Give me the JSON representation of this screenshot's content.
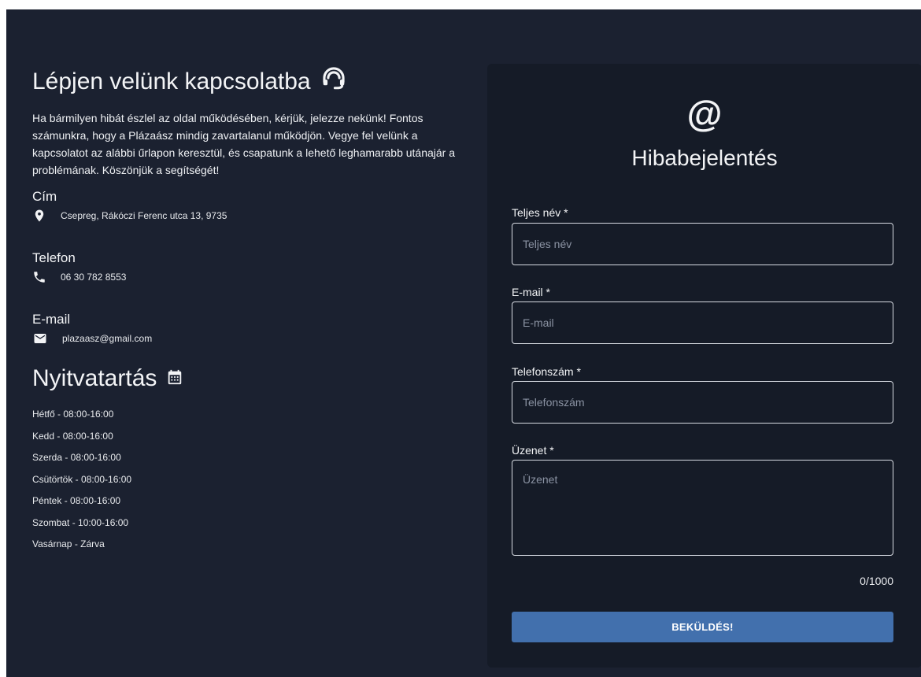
{
  "contact": {
    "title": "Lépjen velünk kapcsolatba",
    "title_icon": "headset-icon",
    "intro": "Ha bármilyen hibát észlel az oldal működésében, kérjük, jelezze nekünk! Fontos számunkra, hogy a Plázaász mindig zavartalanul működjön. Vegye fel velünk a kapcsolatot az alábbi űrlapon keresztül, és csapatunk a lehető leghamarabb utánajár a problémának. Köszönjük a segítségét!",
    "address_label": "Cím",
    "address": "Csepreg, Rákóczi Ferenc utca 13, 9735",
    "phone_label": "Telefon",
    "phone": "06 30 782 8553",
    "email_label": "E-mail",
    "email": "plazaasz@gmail.com"
  },
  "hours": {
    "title": "Nyitvatartás",
    "title_icon": "calendar-icon",
    "items": [
      "Hétfő - 08:00-16:00",
      "Kedd - 08:00-16:00",
      "Szerda - 08:00-16:00",
      "Csütörtök - 08:00-16:00",
      "Péntek - 08:00-16:00",
      "Szombat - 10:00-16:00",
      "Vasárnap - Zárva"
    ]
  },
  "form": {
    "icon": "@",
    "title": "Hibabejelentés",
    "name_label": "Teljes név *",
    "name_placeholder": "Teljes név",
    "email_label": "E-mail *",
    "email_placeholder": "E-mail",
    "phone_label": "Telefonszám *",
    "phone_placeholder": "Telefonszám",
    "message_label": "Üzenet *",
    "message_placeholder": "Üzenet",
    "counter": "0/1000",
    "submit_label": "BEKÜLDÉS!"
  },
  "colors": {
    "background": "#1b2130",
    "card": "#151b27",
    "button": "#4270ad",
    "text": "#e8eaed"
  }
}
